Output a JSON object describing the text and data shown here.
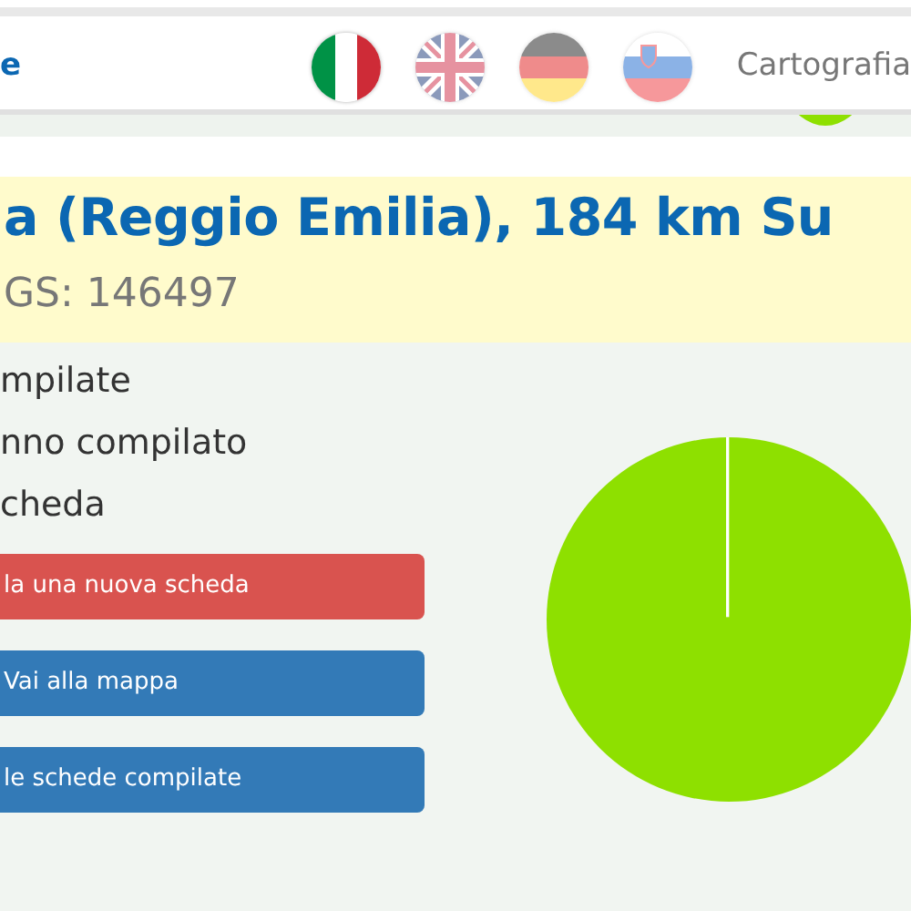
{
  "navbar": {
    "brand": "e",
    "languages": [
      {
        "kind": "italy",
        "selected": true
      },
      {
        "kind": "uk",
        "selected": false
      },
      {
        "kind": "germany",
        "selected": false
      },
      {
        "kind": "slovenia",
        "selected": false
      }
    ],
    "link": "Cartografia"
  },
  "header": {
    "title": "a (Reggio Emilia), 184 km Su",
    "subtitle": "GS: 146497"
  },
  "stats": [
    "mpilate",
    "nno compilato",
    "cheda"
  ],
  "buttons": [
    {
      "label": "la una nuova scheda",
      "kind": "danger"
    },
    {
      "label": "Vai alla mappa",
      "kind": "primary"
    },
    {
      "label": "le schede compilate",
      "kind": "primary"
    }
  ]
}
